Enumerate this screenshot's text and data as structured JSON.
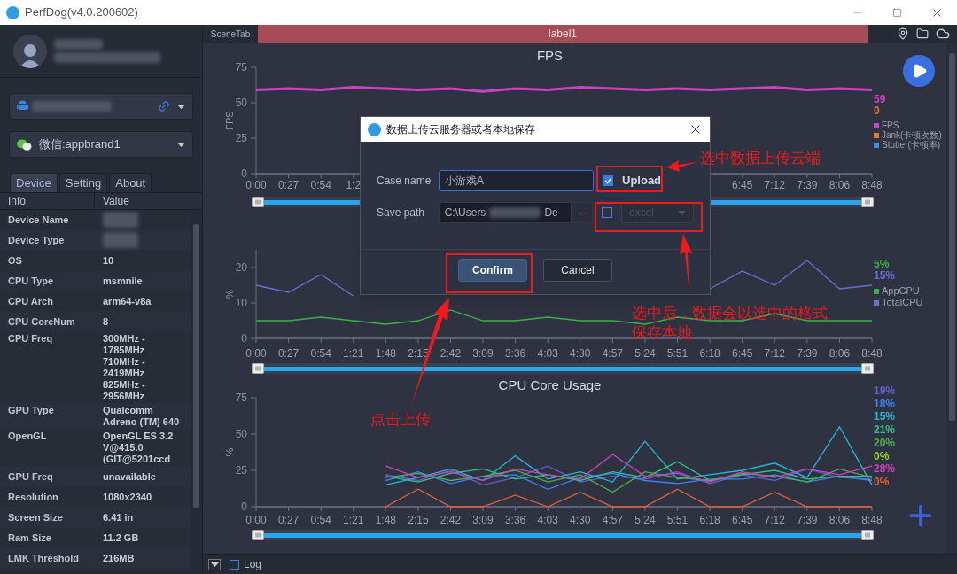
{
  "window": {
    "title": "PerfDog(v4.0.200602)"
  },
  "sidebar": {
    "app_select": {
      "label": "微信:appbrand1"
    },
    "tabs": [
      {
        "label": "Device",
        "selected": true
      },
      {
        "label": "Setting",
        "selected": false
      },
      {
        "label": "About",
        "selected": false
      }
    ],
    "info_table": {
      "columns": [
        "Info",
        "Value"
      ],
      "rows": [
        {
          "info": "Device Name"
        },
        {
          "info": "Device Type"
        },
        {
          "info": "OS",
          "value": "10"
        },
        {
          "info": "CPU Type",
          "value": "msmnile"
        },
        {
          "info": "CPU Arch",
          "value": "arm64-v8a"
        },
        {
          "info": "CPU CoreNum",
          "value": "8"
        },
        {
          "info": "CPU Freq",
          "value": "300MHz -\n1785MHz\n710MHz -\n2419MHz\n825MHz -\n2956MHz"
        },
        {
          "info": "GPU Type",
          "value": "Qualcomm\nAdreno (TM) 640"
        },
        {
          "info": "OpenGL",
          "value": "OpenGL ES 3.2\nV@415.0\n(GIT@5201ccd"
        },
        {
          "info": "GPU Freq",
          "value": "unavailable"
        },
        {
          "info": "Resolution",
          "value": "1080x2340"
        },
        {
          "info": "Screen Size",
          "value": "6.41 in"
        },
        {
          "info": "Ram Size",
          "value": "11.2 GB"
        },
        {
          "info": "LMK Threshold",
          "value": "216MB"
        }
      ]
    }
  },
  "scene_tab": {
    "label": "SceneTab",
    "tab": "label1"
  },
  "charts": [
    {
      "readings": [
        {
          "text": "59",
          "color": "#c944c4"
        },
        {
          "text": "0",
          "color": "#e07b30"
        }
      ],
      "slider": {
        "level": 1
      },
      "chart_data": {
        "type": "line",
        "title": "FPS",
        "ylabel": "FPS",
        "ylim": [
          0,
          75
        ],
        "yticks": [
          0,
          25,
          50,
          75
        ],
        "categories": [
          "0:00",
          "0:27",
          "0:54",
          "1:2",
          null,
          null,
          null,
          null,
          null,
          null,
          null,
          null,
          null,
          null,
          null,
          "6:45",
          "7:12",
          "7:39",
          "8:06",
          "8:48"
        ],
        "series": [
          {
            "name": "FPS",
            "color": "#c944c4",
            "values": [
              59,
              60,
              59,
              61,
              60,
              59,
              60,
              58,
              60,
              59,
              61,
              60,
              59,
              60,
              59,
              60,
              61,
              59,
              60,
              59
            ]
          }
        ]
      },
      "legend_extra": [
        {
          "name": "Jank(卡顿次数)",
          "color": "#e07b30"
        },
        {
          "name": "Stutter(卡顿率)",
          "color": "#3d8ee8"
        }
      ]
    },
    {
      "readings": [
        {
          "text": "5%",
          "color": "#3fae4a"
        },
        {
          "text": "15%",
          "color": "#6a6fd6"
        }
      ],
      "slider": {
        "level": 1
      },
      "chart_data": {
        "type": "line",
        "ylabel": "%",
        "ylim": [
          0,
          25
        ],
        "yticks": [
          0,
          10,
          20
        ],
        "categories": [
          "0:00",
          "0:27",
          "0:54",
          "1:21",
          "1:48",
          "2:15",
          "2:42",
          "3:09",
          "3:36",
          "4:03",
          "4:30",
          "4:57",
          "5:24",
          "5:51",
          "6:18",
          "6:45",
          "7:12",
          "7:39",
          "8:06",
          "8:48"
        ],
        "series": [
          {
            "name": "AppCPU",
            "color": "#3fae4a",
            "values": [
              5,
              5,
              6,
              5,
              4,
              5,
              8,
              5,
              5,
              6,
              5,
              5,
              4,
              6,
              5,
              5,
              7,
              5,
              5,
              5
            ]
          },
          {
            "name": "TotalCPU",
            "color": "#6a6fd6",
            "values": [
              15,
              13,
              18,
              12,
              null,
              null,
              null,
              null,
              null,
              null,
              null,
              null,
              null,
              null,
              14,
              19,
              15,
              22,
              14,
              15
            ]
          }
        ]
      }
    },
    {
      "readings": [
        {
          "text": "19%",
          "color": "#6a5acd"
        },
        {
          "text": "18%",
          "color": "#3b82f6"
        },
        {
          "text": "15%",
          "color": "#22b8d8"
        },
        {
          "text": "21%",
          "color": "#34c08a"
        },
        {
          "text": "20%",
          "color": "#4caf50"
        },
        {
          "text": "0%",
          "color": "#9acd32"
        },
        {
          "text": "28%",
          "color": "#d040c0"
        },
        {
          "text": "0%",
          "color": "#e0603a"
        }
      ],
      "slider": {
        "level": 1
      },
      "chart_data": {
        "type": "line",
        "title": "CPU Core Usage",
        "ylabel": "%",
        "ylim": [
          0,
          75
        ],
        "yticks": [
          0,
          25,
          50,
          75
        ],
        "categories": [
          "0:00",
          "0:27",
          "0:54",
          "1:21",
          "1:48",
          "2:15",
          "2:42",
          "3:09",
          "3:36",
          "4:03",
          "4:30",
          "4:57",
          "5:24",
          "5:51",
          "6:18",
          "6:45",
          "7:12",
          "7:39",
          "8:06",
          "8:48"
        ],
        "series": [
          {
            "color": "#6a5acd",
            "values": [
              null,
              null,
              null,
              null,
              22,
              18,
              25,
              15,
              20,
              28,
              17,
              21,
              19,
              24,
              16,
              22,
              18,
              26,
              20,
              19
            ]
          },
          {
            "color": "#3b82f6",
            "values": [
              null,
              null,
              null,
              null,
              18,
              24,
              16,
              21,
              22,
              12,
              20,
              23,
              18,
              16,
              19,
              19,
              22,
              17,
              21,
              18
            ]
          },
          {
            "color": "#22b8d8",
            "values": [
              null,
              null,
              null,
              null,
              15,
              20,
              26,
              18,
              35,
              19,
              24,
              17,
              45,
              19,
              22,
              25,
              30,
              20,
              55,
              15
            ]
          },
          {
            "color": "#34c08a",
            "values": [
              null,
              null,
              null,
              null,
              21,
              17,
              23,
              26,
              19,
              22,
              18,
              24,
              20,
              31,
              18,
              22,
              25,
              19,
              21,
              21
            ]
          },
          {
            "color": "#4caf50",
            "values": [
              null,
              null,
              null,
              null,
              20,
              23,
              18,
              21,
              25,
              17,
              22,
              10,
              24,
              20,
              18,
              23,
              21,
              17,
              26,
              20
            ]
          },
          {
            "color": "#d040c0",
            "values": [
              null,
              null,
              null,
              null,
              28,
              20,
              24,
              18,
              26,
              22,
              19,
              36,
              21,
              23,
              17,
              24,
              20,
              26,
              22,
              28
            ]
          },
          {
            "color": "#e0603a",
            "values": [
              null,
              null,
              null,
              null,
              0,
              12,
              0,
              0,
              8,
              0,
              10,
              0,
              0,
              12,
              0,
              0,
              10,
              0,
              0,
              0
            ]
          }
        ]
      }
    }
  ],
  "dialog": {
    "title": "数据上传云服务器或者本地保存",
    "case_name": {
      "label": "Case name",
      "value": "小游戏A"
    },
    "upload": {
      "label": "Upload",
      "checked": true
    },
    "save_path": {
      "label": "Save path",
      "value_start": "C:\\Users",
      "value_end": "De",
      "browse": "···"
    },
    "local_save": {
      "checked": false,
      "format": "excel",
      "disabled": true
    },
    "buttons": [
      {
        "label": "Confirm",
        "kind": "primary"
      },
      {
        "label": "Cancel",
        "kind": "secondary"
      }
    ]
  },
  "log": {
    "label": "Log",
    "checked": false
  },
  "annotations": [
    {
      "text": "选中数据上传云端"
    },
    {
      "text": "选中后，数据会以选中的格式保存本地"
    },
    {
      "text": "点击上传"
    }
  ]
}
